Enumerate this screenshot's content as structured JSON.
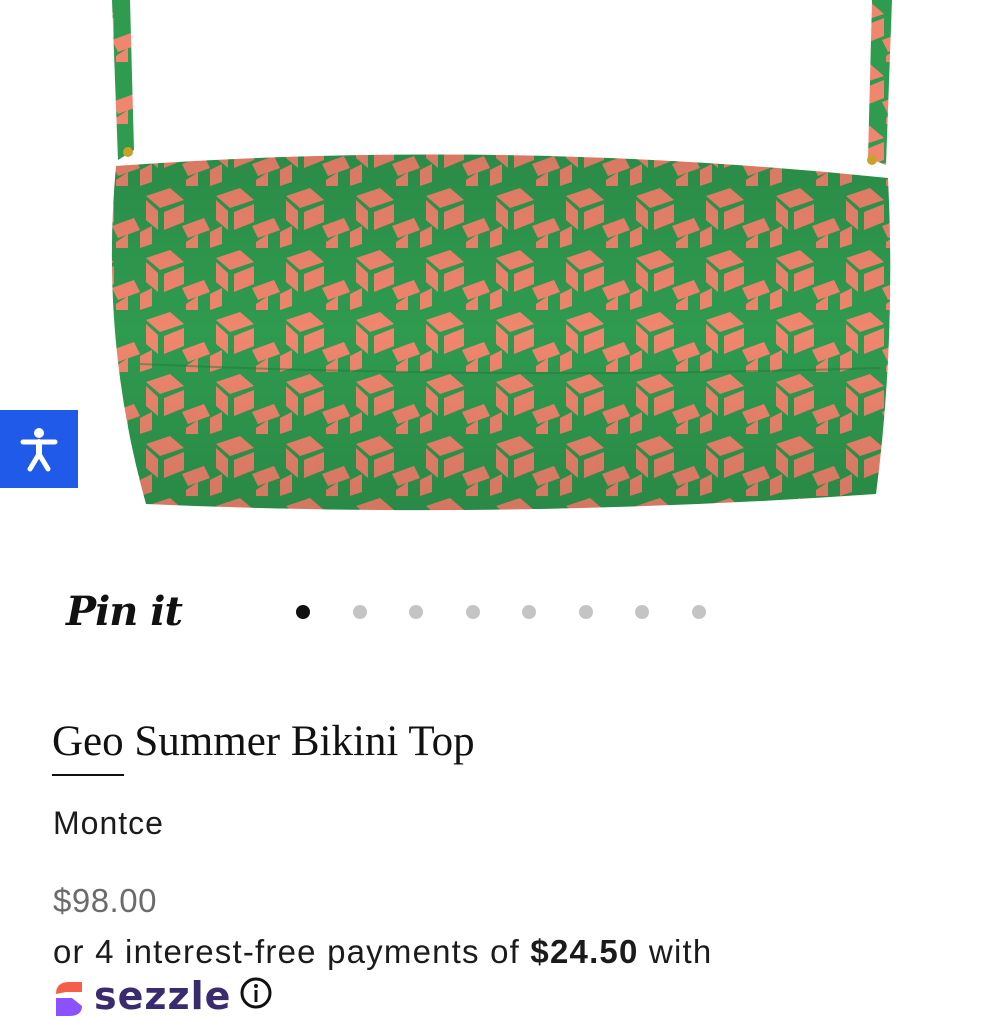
{
  "product": {
    "pin_label": "Pin it",
    "gallery": {
      "slide_count": 8,
      "active_index": 0
    },
    "title_prefix": "Geo",
    "title_rest": " Summer Bikini Top",
    "vendor": "Montce",
    "price": "$98.00",
    "installments": {
      "prefix": "or 4 interest-free payments of ",
      "amount": "$24.50",
      "suffix": " with"
    },
    "sezzle": {
      "name": "sezzle",
      "info_icon": "info-icon"
    }
  },
  "accessibility": {
    "icon": "accessibility-person-icon"
  },
  "colors": {
    "fabric_green": "#2f9b4f",
    "fabric_coral": "#f0866e",
    "accessibility_blue": "#1f5ae8",
    "dot_active": "#111111",
    "dot_inactive": "#c4c4c4",
    "price_gray": "#6b6b6b"
  }
}
